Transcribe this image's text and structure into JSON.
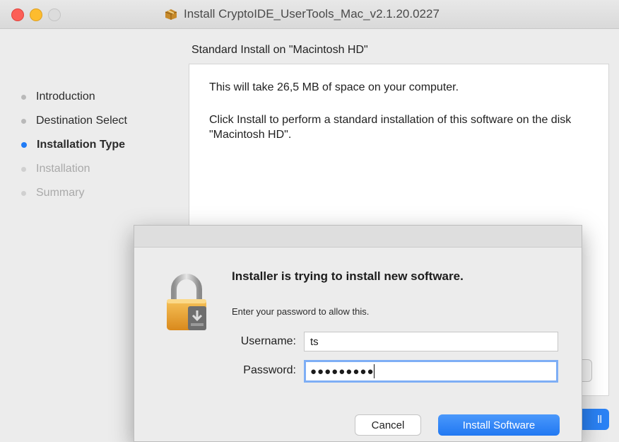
{
  "window": {
    "title": "Install CryptoIDE_UserTools_Mac_v2.1.20.0227",
    "icon": "installer-package-icon"
  },
  "sidebar": {
    "items": [
      {
        "label": "Introduction",
        "state": "done"
      },
      {
        "label": "Destination Select",
        "state": "done"
      },
      {
        "label": "Installation Type",
        "state": "active"
      },
      {
        "label": "Installation",
        "state": "pending"
      },
      {
        "label": "Summary",
        "state": "pending"
      }
    ]
  },
  "main": {
    "heading": "Standard Install on \"Macintosh HD\"",
    "space_text": "This will take 26,5 MB of space on your computer.",
    "instructions": "Click Install to perform a standard installation of this software on the disk \"Macintosh HD\".",
    "install_button_partial": "ll"
  },
  "auth_dialog": {
    "title": "Installer is trying to install new software.",
    "subtitle": "Enter your password to allow this.",
    "username_label": "Username:",
    "username_value": "ts",
    "password_label": "Password:",
    "password_value": "●●●●●●●●●",
    "cancel_label": "Cancel",
    "confirm_label": "Install Software",
    "icon": "lock-icon",
    "accent_color": "#2178f2"
  }
}
